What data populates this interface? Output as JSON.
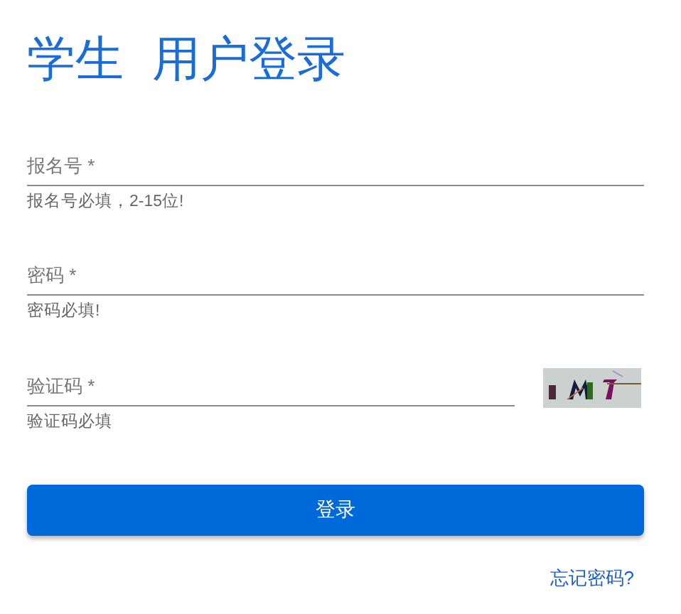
{
  "heading": {
    "prefix": "学生",
    "title": "用户登录"
  },
  "fields": [
    {
      "kind": "text",
      "placeholder": "报名号 *",
      "hint": "报名号必填，2-15位!"
    },
    {
      "kind": "password",
      "placeholder": "密码 *",
      "hint": "密码必填!"
    },
    {
      "kind": "captcha",
      "placeholder": "验证码 *",
      "hint": "验证码必填"
    }
  ],
  "submit_button": "登录",
  "forgot_link": "忘记密码?"
}
